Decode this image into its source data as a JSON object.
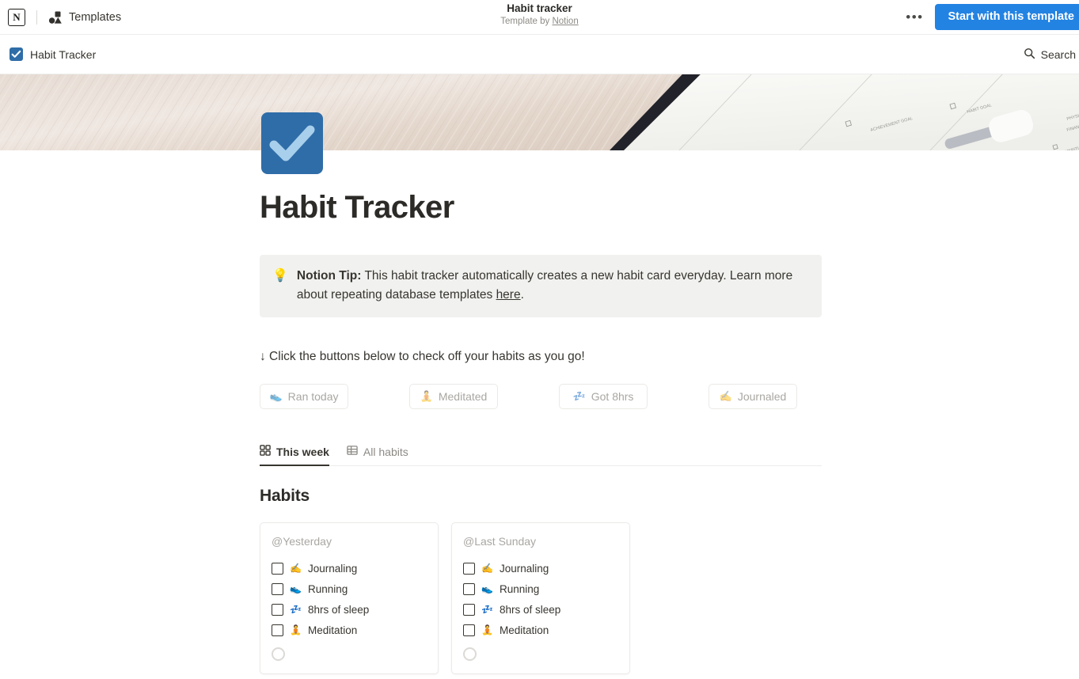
{
  "topbar": {
    "logo_name": "notion-logo",
    "templates_label": "Templates",
    "center_title": "Habit tracker",
    "center_sub_prefix": "Template by ",
    "center_sub_link": "Notion",
    "more_label": "•••",
    "start_button_label": "Start with this template",
    "accent_color": "#2383e2"
  },
  "breadcrumb": {
    "page_label": "Habit Tracker",
    "search_label": "Search",
    "icon_color": "#2f6da8"
  },
  "page": {
    "title": "Habit Tracker",
    "icon_color": "#2f6da8",
    "icon_name": "blue-checkmark-icon"
  },
  "callout": {
    "emoji": "💡",
    "bold_prefix": "Notion Tip:",
    "text_part1": " This habit tracker automatically creates a new habit card everyday. Learn more about repeating database templates ",
    "link_text": "here",
    "text_part2": "."
  },
  "instruction": {
    "text": "↓ Click the buttons below to check off your habits as you go!"
  },
  "habit_buttons": [
    {
      "emoji": "👟",
      "label": "Ran today",
      "icon_name": "running-shoe-icon"
    },
    {
      "emoji": "🧘",
      "label": "Meditated",
      "icon_name": "meditation-icon"
    },
    {
      "emoji": "💤",
      "label": "Got 8hrs",
      "icon_name": "sleep-icon"
    },
    {
      "emoji": "✍️",
      "label": "Journaled",
      "icon_name": "writing-hand-icon"
    }
  ],
  "tabs": [
    {
      "label": "This week",
      "icon_name": "gallery-view-icon",
      "active": true
    },
    {
      "label": "All habits",
      "icon_name": "table-view-icon",
      "active": false
    }
  ],
  "database": {
    "title": "Habits",
    "cards": [
      {
        "title": "@Yesterday",
        "items": [
          {
            "emoji": "✍️",
            "label": "Journaling",
            "checked": false
          },
          {
            "emoji": "👟",
            "label": "Running",
            "checked": false
          },
          {
            "emoji": "💤",
            "label": "8hrs of sleep",
            "checked": false
          },
          {
            "emoji": "🧘",
            "label": "Meditation",
            "checked": false
          }
        ]
      },
      {
        "title": "@Last Sunday",
        "items": [
          {
            "emoji": "✍️",
            "label": "Journaling",
            "checked": false
          },
          {
            "emoji": "👟",
            "label": "Running",
            "checked": false
          },
          {
            "emoji": "💤",
            "label": "8hrs of sleep",
            "checked": false
          },
          {
            "emoji": "🧘",
            "label": "Meditation",
            "checked": false
          }
        ]
      }
    ]
  }
}
